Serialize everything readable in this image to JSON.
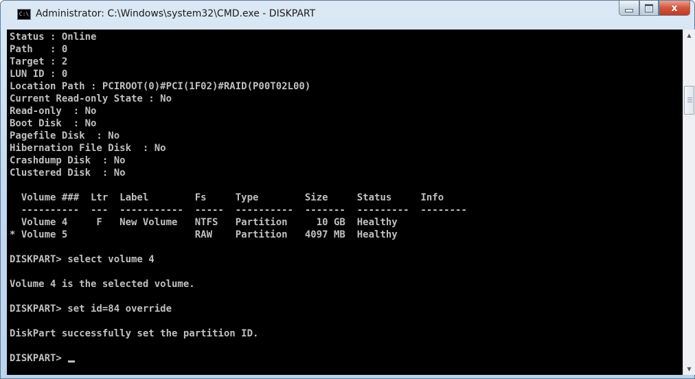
{
  "window": {
    "title": "Administrator: C:\\Windows\\system32\\CMD.exe - DISKPART",
    "icon": "cmd-icon",
    "icon_text": "C:\\"
  },
  "caption": {
    "minimize_icon": "minimize-icon",
    "maximize_icon": "maximize-icon",
    "close_icon": "close-icon",
    "close_glyph": "x"
  },
  "console": {
    "foreground": "#c0c0c0",
    "background": "#000000",
    "lines": [
      "Status : Online",
      "Path   : 0",
      "Target : 2",
      "LUN ID : 0",
      "Location Path : PCIROOT(0)#PCI(1F02)#RAID(P00T02L00)",
      "Current Read-only State : No",
      "Read-only  : No",
      "Boot Disk  : No",
      "Pagefile Disk  : No",
      "Hibernation File Disk  : No",
      "Crashdump Disk  : No",
      "Clustered Disk  : No",
      "",
      "  Volume ###  Ltr  Label        Fs     Type        Size     Status     Info",
      "  ----------  ---  -----------  -----  ----------  -------  ---------  --------",
      "  Volume 4     F   New Volume   NTFS   Partition     10 GB  Healthy",
      "* Volume 5                      RAW    Partition   4097 MB  Healthy",
      "",
      "DISKPART> select volume 4",
      "",
      "Volume 4 is the selected volume.",
      "",
      "DISKPART> set id=84 override",
      "",
      "DiskPart successfully set the partition ID.",
      "",
      "DISKPART> "
    ]
  },
  "scrollbar": {
    "up_arrow_icon": "scroll-up-arrow-icon",
    "down_arrow_icon": "scroll-down-arrow-icon"
  }
}
